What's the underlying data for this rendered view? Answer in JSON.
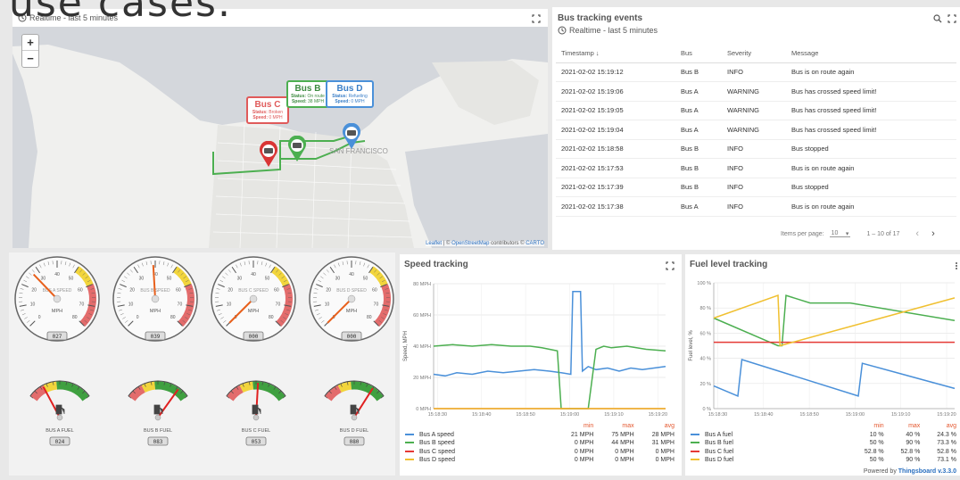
{
  "caption": "use cases.",
  "map": {
    "header": "Realtime - last 5 minutes",
    "zoom_in": "+",
    "zoom_out": "−",
    "city_label": "SAN FRANCISCO",
    "attribution_leaflet": "Leaflet",
    "attribution_osm": "OpenStreetMap",
    "attribution_text": "contributors ©",
    "attribution_carto": "CARTO",
    "buses": [
      {
        "name": "Bus C",
        "status_label": "Status:",
        "status": "Broken",
        "speed_label": "Speed:",
        "speed": "0 MPH",
        "color": "#e05a5a"
      },
      {
        "name": "Bus B",
        "status_label": "Status:",
        "status": "On route",
        "speed_label": "Speed:",
        "speed": "38 MPH",
        "color": "#4caf50"
      },
      {
        "name": "Bus D",
        "status_label": "Status:",
        "status": "Refueling",
        "speed_label": "Speed:",
        "speed": "0 MPH",
        "color": "#4a90d9"
      }
    ]
  },
  "events": {
    "title": "Bus tracking events",
    "subheader": "Realtime - last 5 minutes",
    "columns": [
      "Timestamp ↓",
      "Bus",
      "Severity",
      "Message"
    ],
    "rows": [
      {
        "ts": "2021-02-02 15:19:12",
        "bus": "Bus B",
        "sev": "INFO",
        "msg": "Bus is on route again"
      },
      {
        "ts": "2021-02-02 15:19:06",
        "bus": "Bus A",
        "sev": "WARNING",
        "msg": "Bus has crossed speed limit!"
      },
      {
        "ts": "2021-02-02 15:19:05",
        "bus": "Bus A",
        "sev": "WARNING",
        "msg": "Bus has crossed speed limit!"
      },
      {
        "ts": "2021-02-02 15:19:04",
        "bus": "Bus A",
        "sev": "WARNING",
        "msg": "Bus has crossed speed limit!"
      },
      {
        "ts": "2021-02-02 15:18:58",
        "bus": "Bus B",
        "sev": "INFO",
        "msg": "Bus stopped"
      },
      {
        "ts": "2021-02-02 15:17:53",
        "bus": "Bus B",
        "sev": "INFO",
        "msg": "Bus is on route again"
      },
      {
        "ts": "2021-02-02 15:17:39",
        "bus": "Bus B",
        "sev": "INFO",
        "msg": "Bus stopped"
      },
      {
        "ts": "2021-02-02 15:17:38",
        "bus": "Bus A",
        "sev": "INFO",
        "msg": "Bus is on route again"
      }
    ],
    "items_per_page_label": "Items per page:",
    "items_per_page": "10",
    "range": "1 – 10 of 17"
  },
  "gauges": {
    "speed": [
      {
        "label": "BUS A SPEED",
        "unit": "MPH",
        "value": "027",
        "level": 27
      },
      {
        "label": "BUS B SPEED",
        "unit": "MPH",
        "value": "039",
        "level": 39
      },
      {
        "label": "BUS C SPEED",
        "unit": "MPH",
        "value": "000",
        "level": 0
      },
      {
        "label": "BUS D SPEED",
        "unit": "MPH",
        "value": "000",
        "level": 0
      }
    ],
    "speed_ticks": [
      "0",
      "10",
      "20",
      "30",
      "40",
      "50",
      "60",
      "70",
      "80"
    ],
    "fuel": [
      {
        "label": "BUS A FUEL",
        "value": "024",
        "level": 24
      },
      {
        "label": "BUS B FUEL",
        "value": "083",
        "level": 83
      },
      {
        "label": "BUS C FUEL",
        "value": "053",
        "level": 53
      },
      {
        "label": "BUS D FUEL",
        "value": "080",
        "level": 80
      }
    ]
  },
  "speed_chart": {
    "title": "Speed tracking",
    "legend_header": [
      "min",
      "max",
      "avg"
    ],
    "legend": [
      {
        "name": "Bus A speed",
        "color": "#4a90d9",
        "min": "21 MPH",
        "max": "75 MPH",
        "avg": "28 MPH"
      },
      {
        "name": "Bus B speed",
        "color": "#4caf50",
        "min": "0 MPH",
        "max": "44 MPH",
        "avg": "31 MPH"
      },
      {
        "name": "Bus C speed",
        "color": "#e53935",
        "min": "0 MPH",
        "max": "0 MPH",
        "avg": "0 MPH"
      },
      {
        "name": "Bus D speed",
        "color": "#f0c030",
        "min": "0 MPH",
        "max": "0 MPH",
        "avg": "0 MPH"
      }
    ]
  },
  "fuel_chart": {
    "title": "Fuel level tracking",
    "legend_header": [
      "min",
      "max",
      "avg"
    ],
    "legend": [
      {
        "name": "Bus A fuel",
        "color": "#4a90d9",
        "min": "10 %",
        "max": "40 %",
        "avg": "24.3 %"
      },
      {
        "name": "Bus B fuel",
        "color": "#4caf50",
        "min": "50 %",
        "max": "90 %",
        "avg": "73.3 %"
      },
      {
        "name": "Bus C fuel",
        "color": "#e53935",
        "min": "52.8 %",
        "max": "52.8 %",
        "avg": "52.8 %"
      },
      {
        "name": "Bus D fuel",
        "color": "#f0c030",
        "min": "50 %",
        "max": "90 %",
        "avg": "73.1 %"
      }
    ],
    "powered_by": "Powered by",
    "powered_link": "Thingsboard v.3.3.0"
  },
  "chart_data": [
    {
      "type": "line",
      "title": "Speed tracking",
      "ylabel": "Speed, MPH",
      "ylim": [
        0,
        80
      ],
      "y_ticks": [
        "0 MPH",
        "20 MPH",
        "40 MPH",
        "60 MPH",
        "80 MPH"
      ],
      "x_ticks": [
        "15:18:30",
        "15:18:40",
        "15:18:50",
        "15:19:00",
        "15:19:10",
        "15:19:20"
      ],
      "xlim": [
        0,
        60
      ],
      "series": [
        {
          "name": "Bus A speed",
          "color": "#4a90d9",
          "x": [
            0,
            3,
            6,
            10,
            14,
            18,
            22,
            26,
            30,
            33,
            35.5,
            36,
            38,
            38.5,
            40,
            42,
            45,
            48,
            51,
            54,
            57,
            60
          ],
          "y": [
            22,
            21,
            23,
            22,
            24,
            23,
            24,
            25,
            24,
            23,
            22,
            75,
            75,
            24,
            27,
            25,
            26,
            24,
            26,
            25,
            26,
            27
          ]
        },
        {
          "name": "Bus B speed",
          "color": "#4caf50",
          "x": [
            0,
            5,
            10,
            15,
            20,
            25,
            28,
            30,
            32,
            33,
            40,
            42,
            44,
            46,
            50,
            55,
            60
          ],
          "y": [
            40,
            41,
            40,
            41,
            40,
            40,
            39,
            38,
            37,
            0,
            0,
            38,
            40,
            39,
            40,
            38,
            37
          ]
        },
        {
          "name": "Bus C speed",
          "color": "#e53935",
          "x": [
            0,
            60
          ],
          "y": [
            0,
            0
          ]
        },
        {
          "name": "Bus D speed",
          "color": "#f0c030",
          "x": [
            0,
            60
          ],
          "y": [
            0,
            0
          ]
        }
      ]
    },
    {
      "type": "line",
      "title": "Fuel level tracking",
      "ylabel": "Fuel level, %",
      "ylim": [
        0,
        100
      ],
      "y_ticks": [
        "0 %",
        "20 %",
        "40 %",
        "60 %",
        "80 %",
        "100 %"
      ],
      "x_ticks": [
        "15:18:30",
        "15:18:40",
        "15:18:50",
        "15:19:00",
        "15:19:10",
        "15:19:20"
      ],
      "xlim": [
        0,
        60
      ],
      "series": [
        {
          "name": "Bus A fuel",
          "color": "#4a90d9",
          "x": [
            0,
            6,
            7,
            36,
            37,
            60
          ],
          "y": [
            18,
            10,
            39,
            10,
            36,
            16
          ]
        },
        {
          "name": "Bus B fuel",
          "color": "#4caf50",
          "x": [
            0,
            16,
            17,
            18,
            24,
            34,
            60
          ],
          "y": [
            72,
            50,
            50,
            90,
            84,
            84,
            70
          ]
        },
        {
          "name": "Bus C fuel",
          "color": "#e53935",
          "x": [
            0,
            60
          ],
          "y": [
            52.8,
            52.8
          ]
        },
        {
          "name": "Bus D fuel",
          "color": "#f0c030",
          "x": [
            0,
            16,
            16.5,
            60
          ],
          "y": [
            72,
            90,
            50,
            88
          ]
        }
      ]
    }
  ]
}
